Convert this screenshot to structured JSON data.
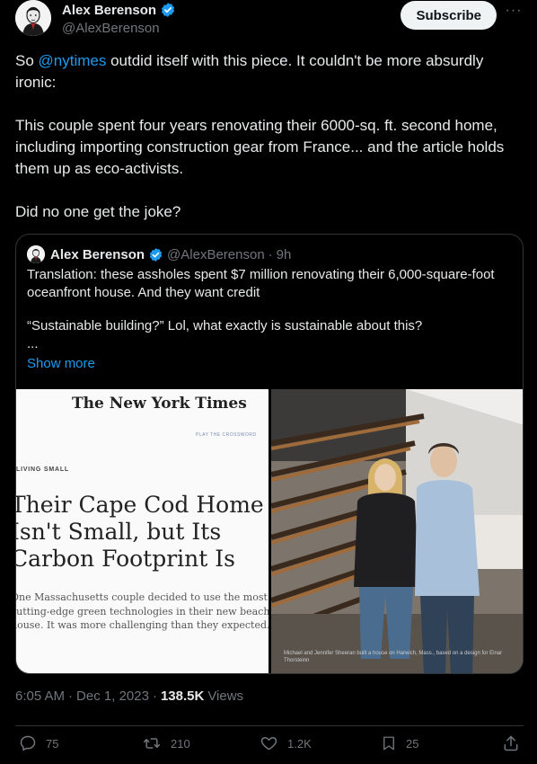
{
  "author": {
    "name": "Alex Berenson",
    "handle": "@AlexBerenson"
  },
  "header": {
    "subscribe_label": "Subscribe",
    "more_label": "···"
  },
  "post": {
    "lead": "So ",
    "mention": "@nytimes",
    "lead_rest": " outdid itself with this piece. It couldn't be more absurdly ironic:",
    "paragraph2": "This couple spent four years renovating their 6000-sq. ft. second home, including importing construction gear from France... and the article holds them up as eco-activists.",
    "paragraph3": "Did no one get the joke?"
  },
  "quote": {
    "name": "Alex Berenson",
    "handle": "@AlexBerenson",
    "dot": "·",
    "time": "9h",
    "line1": "Translation: these assholes spent $7 million renovating their 6,000-square-foot oceanfront house. And they want credit",
    "line2": "“Sustainable building?” Lol, what exactly is sustainable about this?",
    "ellipsis": "...",
    "show_more": "Show more"
  },
  "media": {
    "nyt_masthead": "The New York Times",
    "nyt_small": "PLAY THE CROSSWORD",
    "nyt_kicker": "LIVING SMALL",
    "nyt_headline": "Their Cape Cod Home Isn't Small, but Its Carbon Footprint Is",
    "nyt_summary": "One Massachusetts couple decided to use the most cutting-edge green technologies in their new beach house. It was more challenging than they expected.",
    "photo_caption": "Michael and Jennifer Sheeran built a house on Harwich, Mass., based on a design for Einar Thorsteinn"
  },
  "meta": {
    "time": "6:05 AM",
    "sep": "·",
    "date": "Dec 1, 2023",
    "sep2": "·",
    "views_count": "138.5K",
    "views_label": "Views"
  },
  "actions": {
    "replies": "75",
    "reposts": "210",
    "likes": "1.2K",
    "bookmarks": "25"
  },
  "colors": {
    "background": "#000000",
    "accent": "#1d9bf0",
    "muted": "#71767b",
    "text": "#e7e9ea",
    "border": "#2f3336"
  }
}
